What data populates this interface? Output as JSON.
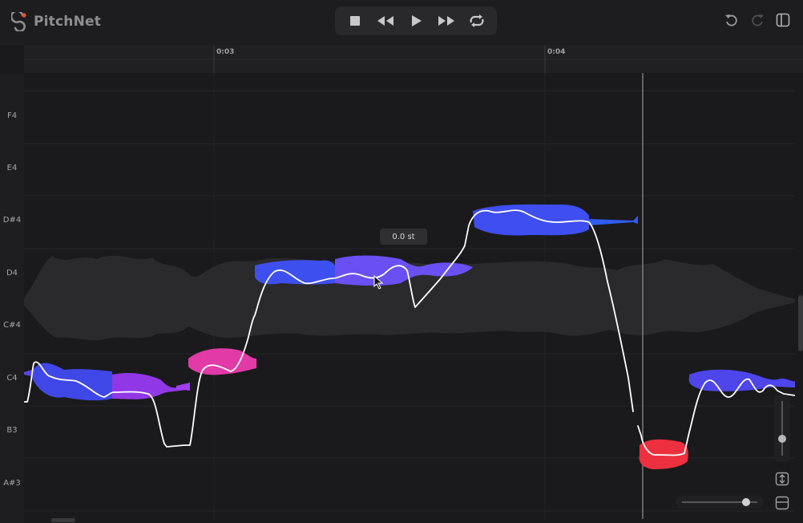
{
  "app": {
    "name": "PitchNet"
  },
  "ruler": {
    "ticks": [
      "0:03",
      "0:04"
    ]
  },
  "piano_keys": [
    "F4",
    "E4",
    "D#4",
    "D4",
    "C#4",
    "C4",
    "B3",
    "A#3"
  ],
  "tooltip": {
    "text": "0.0 st"
  },
  "icons": {
    "logo": "pitchnet-logo-icon",
    "stop": "stop-icon",
    "rewind": "rewind-icon",
    "play": "play-icon",
    "fast_forward": "fast-forward-icon",
    "loop": "loop-icon",
    "undo": "undo-icon",
    "redo": "redo-icon",
    "panel": "panel-toggle-icon",
    "fit_vertical": "fit-vertical-icon",
    "fit_horizontal": "fit-horizontal-icon"
  },
  "colors": {
    "note_blue": "#3f4ef0",
    "note_violet": "#7a5cf0",
    "note_purple": "#8e3fe8",
    "note_pink": "#e63aa8",
    "note_red": "#ec3040",
    "pitch_curve": "#ffffff",
    "playhead": "#8a8a8e"
  },
  "zoom": {
    "vertical_level": 0.6,
    "horizontal_level": 0.85
  }
}
